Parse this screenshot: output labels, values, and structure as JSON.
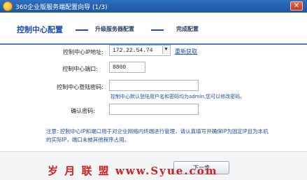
{
  "window": {
    "title": "360企业版服务端配置向导 (1/3)",
    "close_label": "✕"
  },
  "steps": {
    "active": "控制中心配置",
    "step2": "升级服务器配置",
    "step3": "完成配置"
  },
  "form": {
    "ip_label": "控制中心IP地址:",
    "ip_value": "172.22.54.74",
    "refresh_link": "重新获取",
    "port_label": "控制中心端口:",
    "port_value": "8800",
    "password_label": "控制中心登陆密码:",
    "password_value": "",
    "password_hint": "控制中心默认登陆用户名和密码均为admin,您可以修改密码。",
    "confirm_label": "确认密码:",
    "confirm_value": ""
  },
  "note": "注意: 控制中心IP和端口用于对企业网络内终端进行管理，请认真填写并确保IP为固定IP且为本机的实际IP，端口未被其他程序占用。",
  "footer": {
    "watermark": "岁 月 联 盟  www.Syue.com",
    "next_label": "下一步"
  }
}
